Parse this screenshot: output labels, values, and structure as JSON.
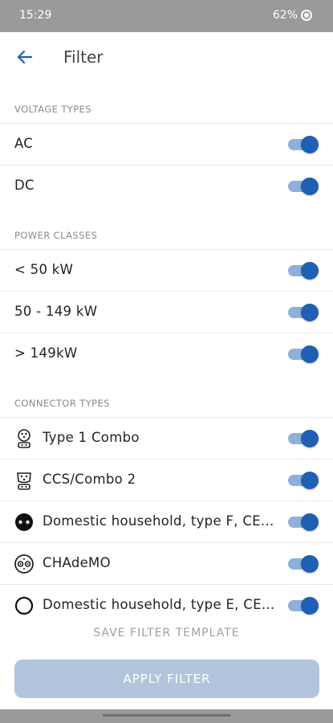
{
  "status_bar": {
    "time": "15:29",
    "battery": "62%"
  },
  "header": {
    "title": "Filter",
    "back_icon": "arrow-left-icon"
  },
  "colors": {
    "accent": "#1f5fb4",
    "track": "#8fb0d8",
    "apply_button": "#b3c5dc"
  },
  "sections": {
    "voltage": {
      "title": "VOLTAGE TYPES",
      "items": [
        {
          "label": "AC",
          "enabled": true
        },
        {
          "label": "DC",
          "enabled": true
        }
      ]
    },
    "power": {
      "title": "POWER CLASSES",
      "items": [
        {
          "label": "< 50 kW",
          "enabled": true
        },
        {
          "label": "50 - 149 kW",
          "enabled": true
        },
        {
          "label": "> 149kW",
          "enabled": true
        }
      ]
    },
    "connectors": {
      "title": "CONNECTOR TYPES",
      "items": [
        {
          "label": "Type 1 Combo",
          "icon": "type1-combo-icon",
          "enabled": true
        },
        {
          "label": "CCS/Combo 2",
          "icon": "ccs-combo2-icon",
          "enabled": true
        },
        {
          "label": "Domestic household, type F, CE...",
          "icon": "schuko-plug-icon",
          "enabled": true
        },
        {
          "label": "CHAdeMO",
          "icon": "chademo-icon",
          "enabled": true
        },
        {
          "label": "Domestic household, type E, CE...",
          "icon": "type-e-plug-icon",
          "enabled": true
        }
      ]
    }
  },
  "actions": {
    "save_template": "SAVE FILTER TEMPLATE",
    "apply": "APPLY FILTER"
  }
}
